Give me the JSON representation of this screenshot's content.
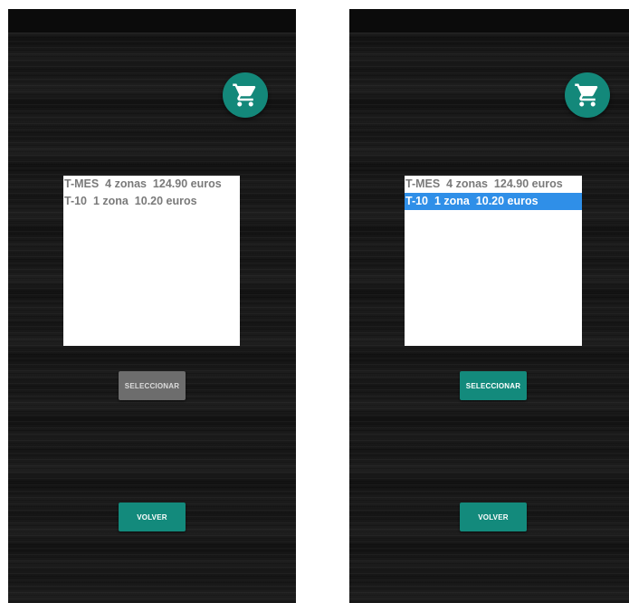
{
  "colors": {
    "accent": "#138a7c",
    "selection": "#2f8fe8",
    "disabled_button": "#6d6d6d"
  },
  "screens": [
    {
      "cart_icon": "shopping-cart-icon",
      "list": [
        {
          "label": "T-MES  4 zonas  124.90 euros",
          "selected": false
        },
        {
          "label": "T-10  1 zona  10.20 euros",
          "selected": false
        }
      ],
      "select_button": {
        "label": "SELECCIONAR",
        "enabled": false
      },
      "back_button": {
        "label": "VOLVER"
      }
    },
    {
      "cart_icon": "shopping-cart-icon",
      "list": [
        {
          "label": "T-MES  4 zonas  124.90 euros",
          "selected": false
        },
        {
          "label": "T-10  1 zona  10.20 euros",
          "selected": true
        }
      ],
      "select_button": {
        "label": "SELECCIONAR",
        "enabled": true
      },
      "back_button": {
        "label": "VOLVER"
      }
    }
  ]
}
